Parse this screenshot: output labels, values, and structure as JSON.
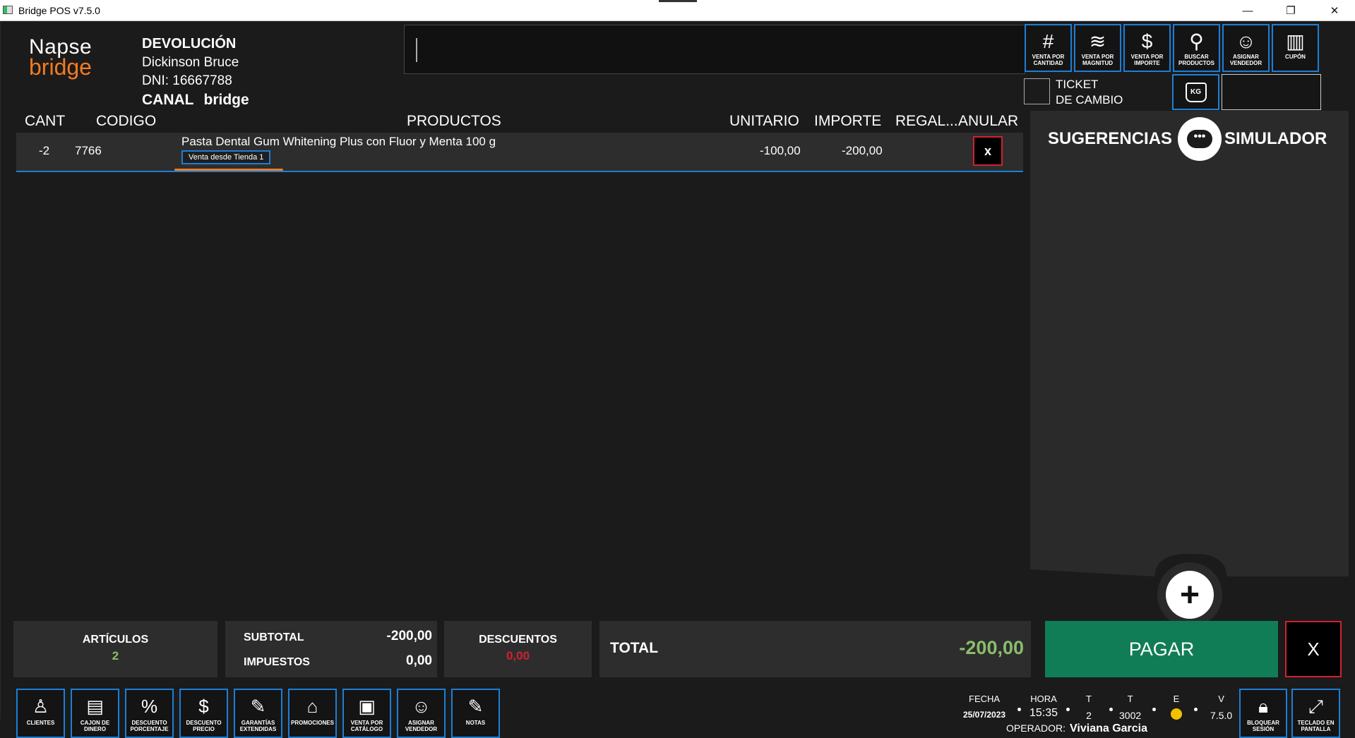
{
  "window": {
    "title": "Bridge POS v7.5.0"
  },
  "brand": {
    "line1": "Napse",
    "line2": "bridge"
  },
  "customer": {
    "mode": "DEVOLUCIÓN",
    "name": "Dickinson Bruce",
    "dni": "DNI: 16667788",
    "canal_label": "CANAL",
    "canal_value": "bridge"
  },
  "tools": [
    {
      "label": "VENTA POR\nCANTIDAD",
      "icon": "hash-icon",
      "glyph": "#"
    },
    {
      "label": "VENTA POR\nMAGNITUD",
      "icon": "layers-icon",
      "glyph": "≋"
    },
    {
      "label": "VENTA POR\nIMPORTE",
      "icon": "dollar-icon",
      "glyph": "$"
    },
    {
      "label": "BUSCAR\nPRODUCTOS",
      "icon": "search-icon",
      "glyph": "⚲"
    },
    {
      "label": "ASIGNAR\nVENDEDOR",
      "icon": "headset-icon",
      "glyph": "☺"
    },
    {
      "label": "CUPÓN",
      "icon": "barcode-icon",
      "glyph": "▥"
    }
  ],
  "ticket_cambio": "TICKET\nDE CAMBIO",
  "kg_label": "KG",
  "table": {
    "headers": [
      "CANT",
      "CODIGO",
      "PRODUCTOS",
      "UNITARIO",
      "IMPORTE",
      "REGAL...",
      "ANULAR"
    ],
    "rows": [
      {
        "cant": "-2",
        "codigo": "7766",
        "producto": "Pasta Dental Gum Whitening Plus con Fluor y Menta 100 g",
        "origen": "Venta desde Tienda 1",
        "unitario": "-100,00",
        "importe": "-200,00",
        "anular": "x"
      }
    ]
  },
  "panel": {
    "sugerencias": "SUGERENCIAS",
    "simulador": "SIMULADOR",
    "chat_glyph": "•••",
    "plus_glyph": "+"
  },
  "totals": {
    "articulos_label": "ARTÍCULOS",
    "articulos_value": "2",
    "subtotal_label": "SUBTOTAL",
    "subtotal_value": "-200,00",
    "impuestos_label": "IMPUESTOS",
    "impuestos_value": "0,00",
    "descuentos_label": "DESCUENTOS",
    "descuentos_value": "0,00",
    "total_label": "TOTAL",
    "total_value": "-200,00",
    "pagar": "PAGAR",
    "cancel": "X"
  },
  "bottom_buttons": [
    {
      "label": "CLIENTES",
      "icon": "user-icon",
      "glyph": "♙"
    },
    {
      "label": "CAJON DE\nDINERO",
      "icon": "cash-drawer-icon",
      "glyph": "▤"
    },
    {
      "label": "DESCUENTO\nPORCENTAJE",
      "icon": "percent-discount-icon",
      "glyph": "%"
    },
    {
      "label": "DESCUENTO\nPRECIO",
      "icon": "price-discount-icon",
      "glyph": "$"
    },
    {
      "label": "GARANTÍAS\nEXTENDIDAS",
      "icon": "warranty-icon",
      "glyph": "✎"
    },
    {
      "label": "PROMOCIONES",
      "icon": "tag-icon",
      "glyph": "⌂"
    },
    {
      "label": "VENTA POR\nCATÁLOGO",
      "icon": "catalog-icon",
      "glyph": "▣"
    },
    {
      "label": "ASIGNAR\nVENDEDOR",
      "icon": "headset-icon",
      "glyph": "☺"
    },
    {
      "label": "NOTAS",
      "icon": "note-icon",
      "glyph": "✎"
    }
  ],
  "status": {
    "fecha_label": "FECHA",
    "fecha": "25/07/2023",
    "hora_label": "HORA",
    "hora": "15:35",
    "t1_label": "T",
    "t1": "2",
    "t2_label": "T",
    "t2": "3002",
    "e_label": "E",
    "e_color": "#f2c200",
    "v_label": "V",
    "v": "7.5.0",
    "operador_label": "OPERADOR:",
    "operador": "Viviana Garcia"
  },
  "right_buttons": [
    {
      "label": "BLOQUEAR\nSESIÓN",
      "icon": "lock-icon",
      "glyph": "🔒︎"
    },
    {
      "label": "TECLADO EN\nPANTALLA",
      "icon": "keyboard-icon",
      "glyph": "⤢"
    }
  ],
  "colors": {
    "accent": "#1c7fd6",
    "brand": "#f47b20",
    "pay": "#117d56",
    "danger": "#d0222f",
    "positive": "#8bbd6b"
  }
}
